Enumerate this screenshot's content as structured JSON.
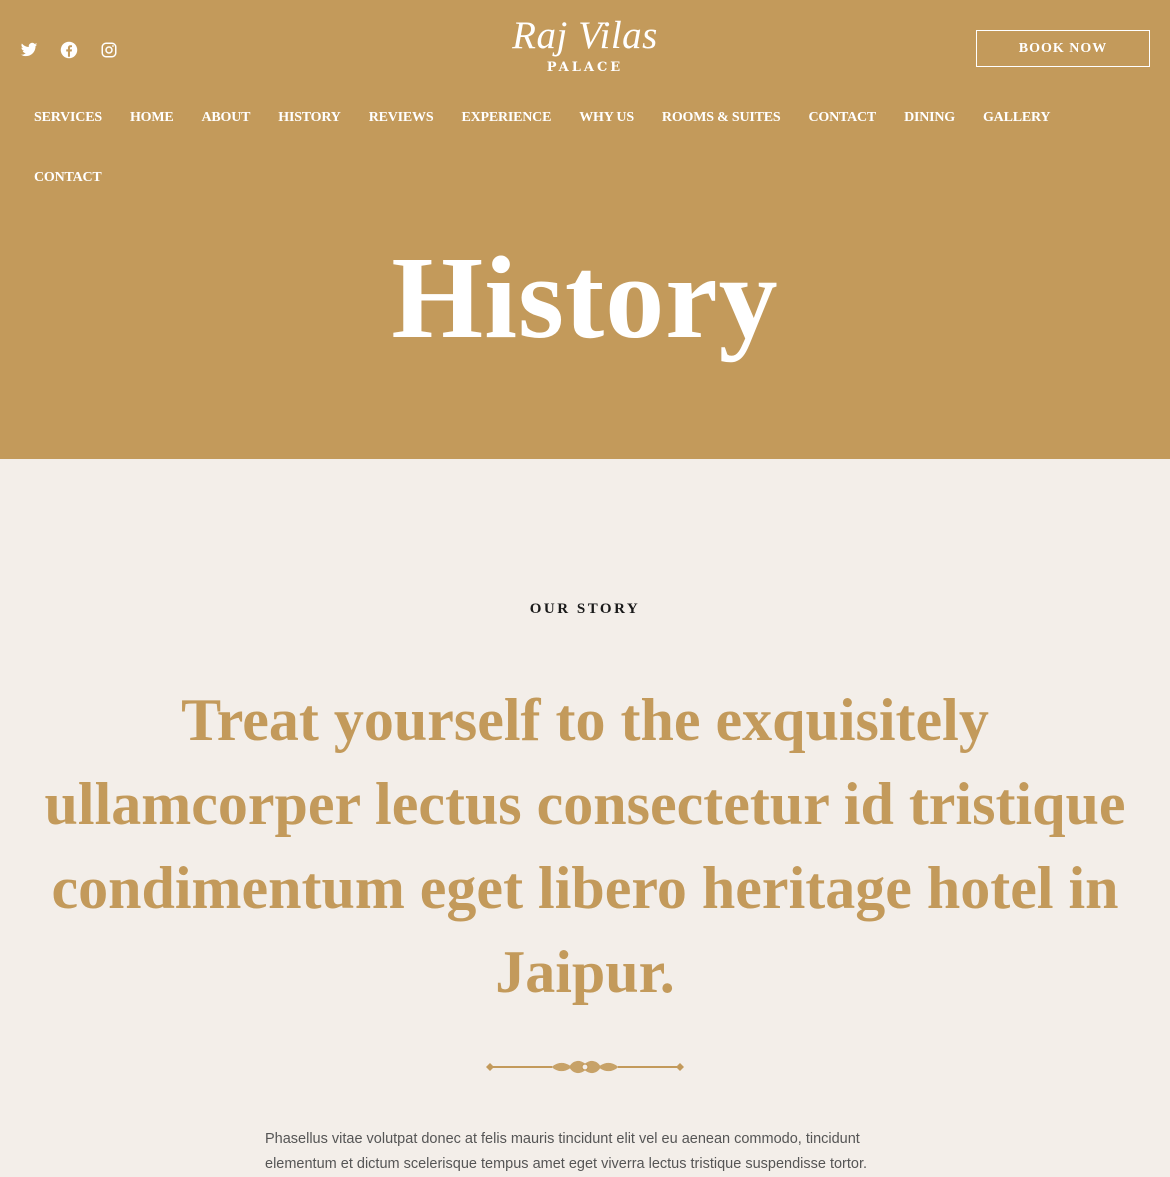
{
  "brand": {
    "name": "Raj Vilas",
    "subtitle": "PALACE"
  },
  "header": {
    "book_label": "BOOK NOW"
  },
  "social": [
    "twitter-icon",
    "facebook-icon",
    "instagram-icon"
  ],
  "nav": {
    "items": [
      {
        "label": "SERVICES"
      },
      {
        "label": "HOME"
      },
      {
        "label": "ABOUT"
      },
      {
        "label": "HISTORY"
      },
      {
        "label": "REVIEWS"
      },
      {
        "label": "EXPERIENCE"
      },
      {
        "label": "WHY US"
      },
      {
        "label": "ROOMS & SUITES"
      },
      {
        "label": "CONTACT"
      },
      {
        "label": "DINING"
      },
      {
        "label": "GALLERY"
      },
      {
        "label": "CONTACT"
      }
    ],
    "active": "HISTORY"
  },
  "hero": {
    "title": "History"
  },
  "story": {
    "eyebrow": "OUR STORY",
    "headline": "Treat yourself to the exquisitely ullamcorper lectus consectetur id tristique condimentum eget libero heritage hotel in Jaipur.",
    "body": "Phasellus vitae volutpat donec at felis mauris tincidunt elit vel eu aenean commodo, tincidunt elementum et dictum scelerisque tempus amet eget viverra lectus tristique suspendisse tortor."
  },
  "colors": {
    "accent": "#c39a5b",
    "background": "#f3eee9",
    "text": "#555555"
  }
}
